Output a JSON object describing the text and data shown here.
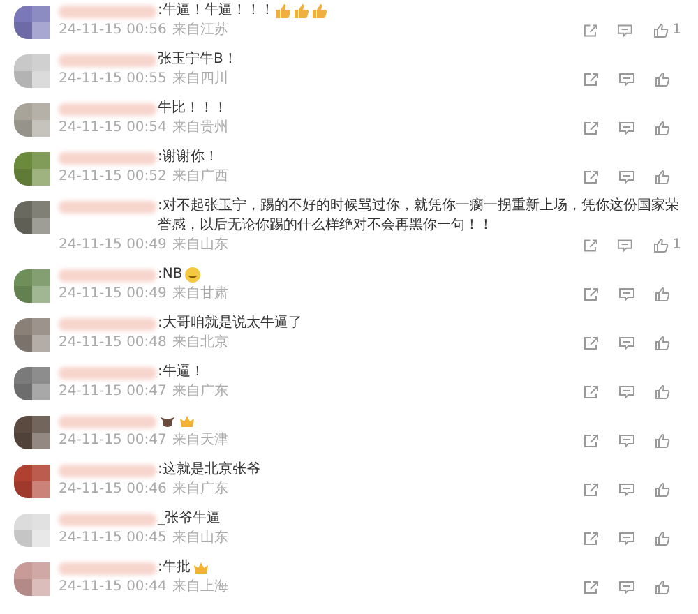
{
  "comments": [
    {
      "color": "#7a78b8",
      "text": ":牛逼！牛逼！！！",
      "emojis": [
        {
          "kind": "thumbs"
        },
        {
          "kind": "thumbs"
        },
        {
          "kind": "thumbs"
        }
      ],
      "time": "24-11-15 00:56",
      "location": "来自江苏",
      "likes": "1"
    },
    {
      "color": "#c8c8c8",
      "text": "张玉宁牛B！",
      "time": "24-11-15 00:55",
      "location": "来自四川"
    },
    {
      "color": "#a8a49a",
      "text": "牛比！！！",
      "time": "24-11-15 00:54",
      "location": "来自贵州"
    },
    {
      "color": "#6b8a3c",
      "text": ":谢谢你！",
      "time": "24-11-15 00:52",
      "location": "来自广西"
    },
    {
      "color": "#6a6a60",
      "text": ":对不起张玉宁，踢的不好的时候骂过你，就凭你一瘸一拐重新上场，凭你这份国家荣誉感，以后无论你踢的什么样绝对不会再黑你一句！！",
      "time": "24-11-15 00:49",
      "location": "来自山东",
      "likes": "1"
    },
    {
      "color": "#6f8f5a",
      "text": ":NB",
      "emojis": [
        {
          "kind": "grin"
        }
      ],
      "time": "24-11-15 00:49",
      "location": "来自甘肃"
    },
    {
      "color": "#8a8078",
      "text": ":大哥咱就是说太牛逼了",
      "time": "24-11-15 00:48",
      "location": "来自北京"
    },
    {
      "color": "#7a7a7a",
      "text": ":牛逼！",
      "time": "24-11-15 00:47",
      "location": "来自广东"
    },
    {
      "color": "#5a4a40",
      "emojis": [
        {
          "kind": "cow"
        },
        {
          "kind": "crown"
        }
      ],
      "time": "24-11-15 00:47",
      "location": "来自天津"
    },
    {
      "color": "#b04030",
      "text": ":这就是北京张爷",
      "time": "24-11-15 00:46",
      "location": "来自广东"
    },
    {
      "color": "#dcdcdc",
      "text": "_张爷牛逼",
      "time": "24-11-15 00:45",
      "location": "来自山东"
    },
    {
      "color": "#c89a98",
      "text": ":牛批",
      "emojis": [
        {
          "kind": "crown"
        }
      ],
      "time": "24-11-15 00:44",
      "location": "来自上海"
    }
  ]
}
